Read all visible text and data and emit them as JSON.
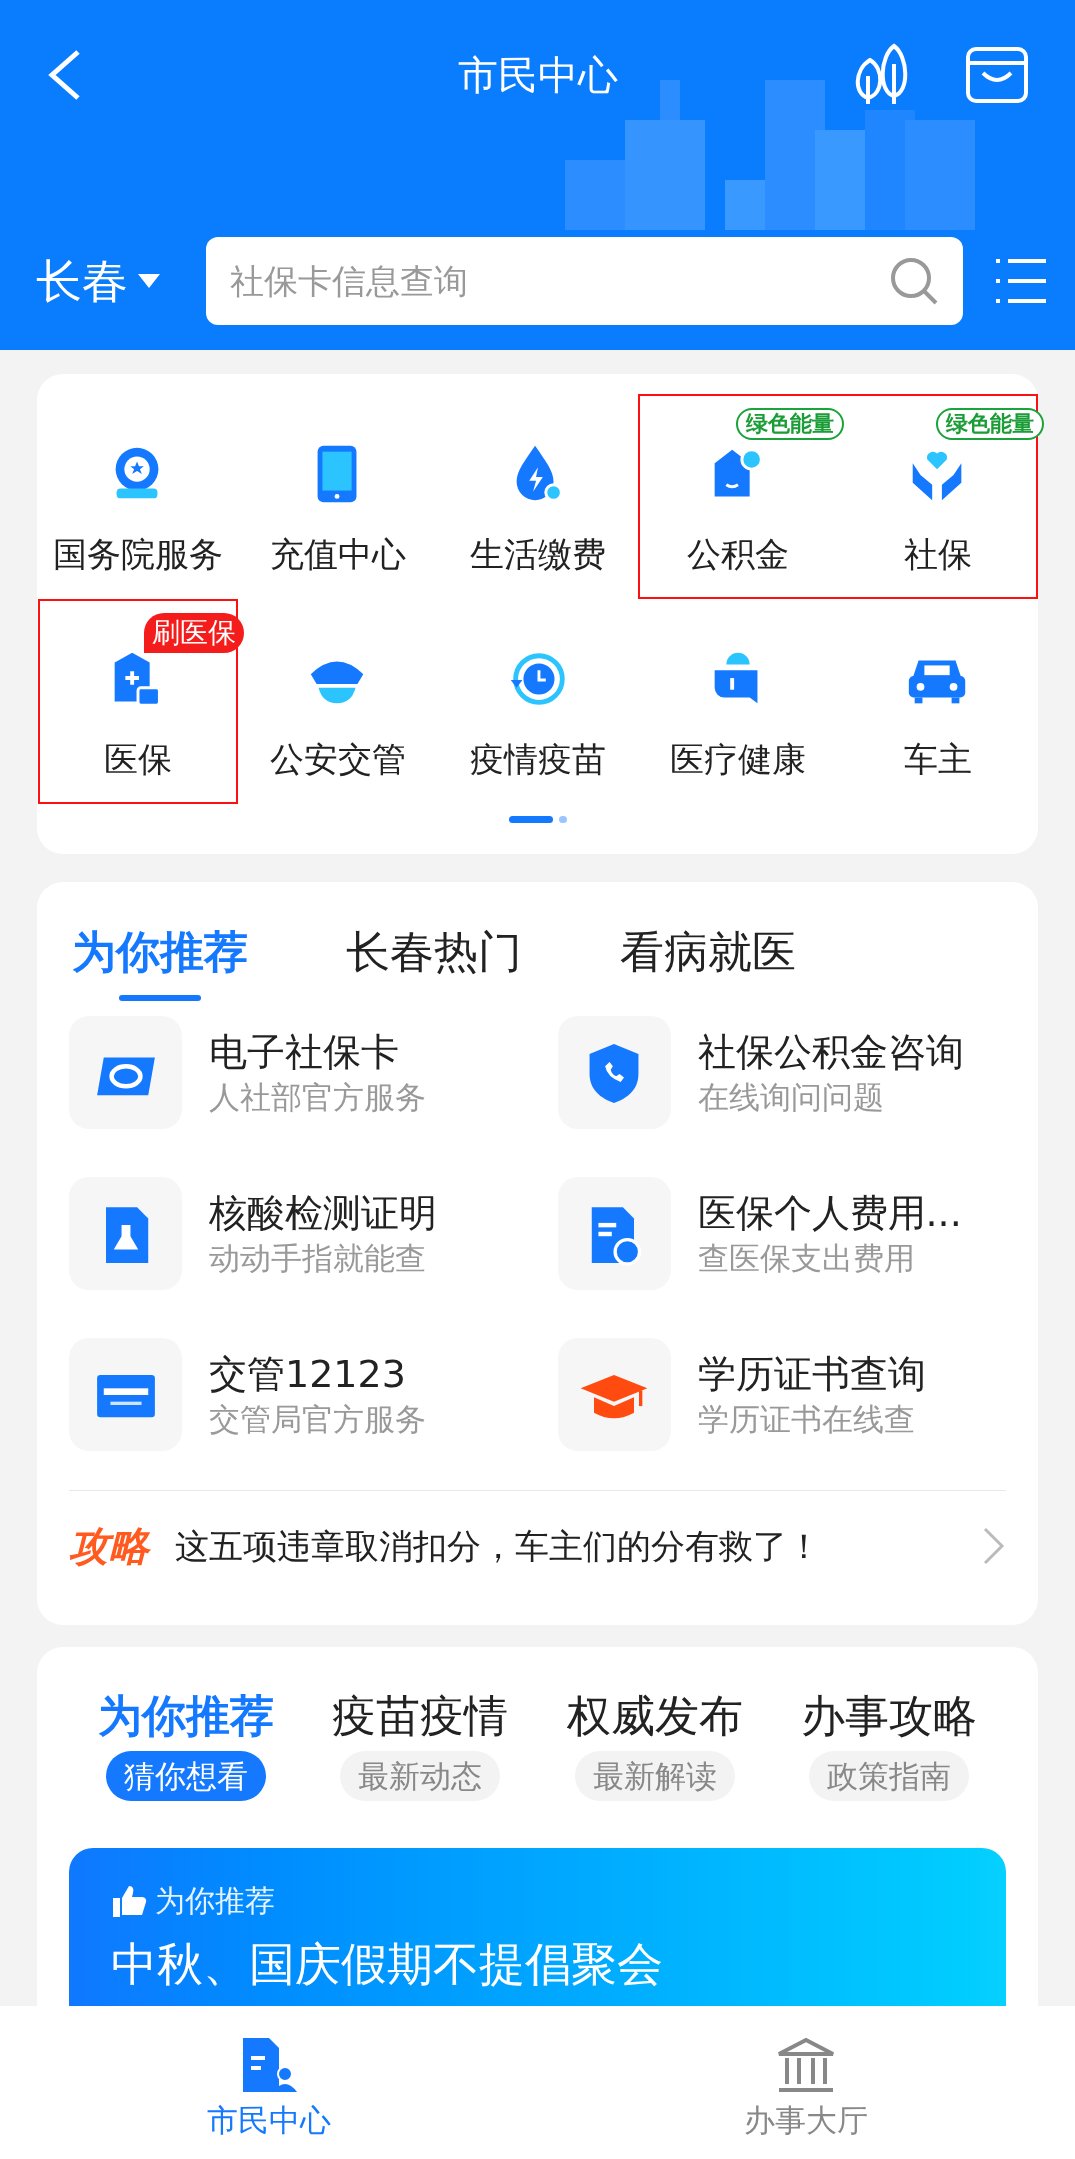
{
  "header": {
    "title": "市民中心",
    "city": "长春",
    "search": {
      "placeholder": "社保卡信息查询"
    }
  },
  "services": {
    "rows": [
      [
        {
          "label": "国务院服务",
          "highlighted": false
        },
        {
          "label": "充值中心",
          "highlighted": false
        },
        {
          "label": "生活缴费",
          "highlighted": false
        },
        {
          "label": "公积金",
          "highlighted": true,
          "badge": {
            "text": "绿色能量",
            "kind": "outline"
          }
        },
        {
          "label": "社保",
          "highlighted": true,
          "badge": {
            "text": "绿色能量",
            "kind": "outline"
          }
        }
      ],
      [
        {
          "label": "医保",
          "highlighted": true,
          "badge": {
            "text": "刷医保",
            "kind": "filled"
          }
        },
        {
          "label": "公安交管",
          "highlighted": false
        },
        {
          "label": "疫情疫苗",
          "highlighted": false
        },
        {
          "label": "医疗健康",
          "highlighted": false
        },
        {
          "label": "车主",
          "highlighted": false
        }
      ]
    ],
    "pages": [
      {
        "selected": true
      },
      {
        "selected": false
      }
    ]
  },
  "recommend": {
    "tabs": [
      {
        "label": "为你推荐",
        "selected": true
      },
      {
        "label": "长春热门",
        "selected": false
      },
      {
        "label": "看病就医",
        "selected": false
      }
    ],
    "items": [
      {
        "title": "电子社保卡",
        "subtitle": "人社部官方服务"
      },
      {
        "title": "社保公积金咨询",
        "subtitle": "在线询问问题"
      },
      {
        "title": "核酸检测证明",
        "subtitle": "动动手指就能查"
      },
      {
        "title": "医保个人费用...",
        "subtitle": "查医保支出费用"
      },
      {
        "title": "交管12123",
        "subtitle": "交管局官方服务"
      },
      {
        "title": "学历证书查询",
        "subtitle": "学历证书在线查"
      }
    ],
    "tip": {
      "tag": "攻略",
      "text": "这五项违章取消扣分，车主们的分有救了！"
    }
  },
  "feed": {
    "tabs": [
      {
        "label": "为你推荐",
        "sub": "猜你想看",
        "selected": true
      },
      {
        "label": "疫苗疫情",
        "sub": "最新动态",
        "selected": false
      },
      {
        "label": "权威发布",
        "sub": "最新解读",
        "selected": false
      },
      {
        "label": "办事攻略",
        "sub": "政策指南",
        "selected": false
      }
    ],
    "banner": {
      "tag": "为你推荐",
      "headline": "中秋、国庆假期不提倡聚会"
    }
  },
  "bottom_nav": [
    {
      "label": "市民中心",
      "selected": true
    },
    {
      "label": "办事大厅",
      "selected": false
    }
  ]
}
